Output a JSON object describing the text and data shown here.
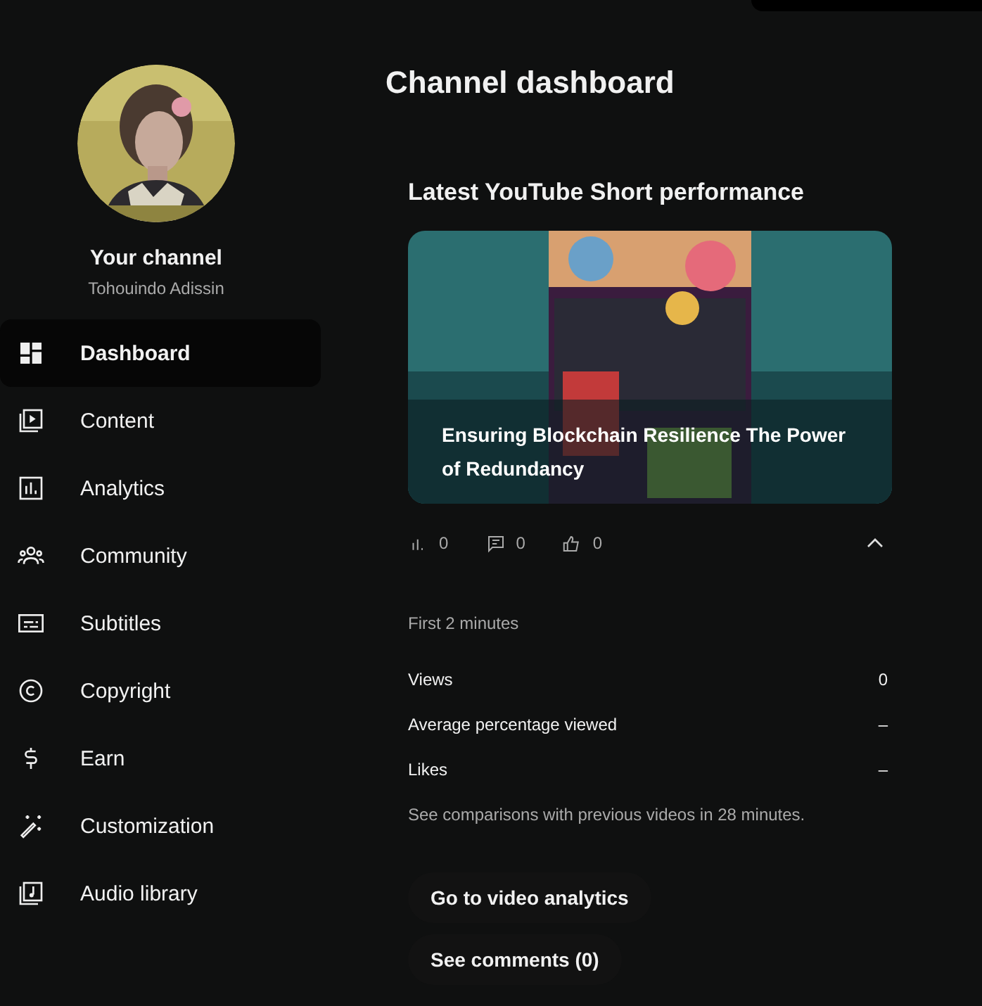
{
  "channel": {
    "title": "Your channel",
    "name": "Tohouindo Adissin"
  },
  "nav": [
    {
      "label": "Dashboard",
      "kind": "dashboard",
      "selected": true
    },
    {
      "label": "Content",
      "kind": "content",
      "selected": false
    },
    {
      "label": "Analytics",
      "kind": "analytics",
      "selected": false
    },
    {
      "label": "Community",
      "kind": "community",
      "selected": false
    },
    {
      "label": "Subtitles",
      "kind": "subtitles",
      "selected": false
    },
    {
      "label": "Copyright",
      "kind": "copyright",
      "selected": false
    },
    {
      "label": "Earn",
      "kind": "earn",
      "selected": false
    },
    {
      "label": "Customization",
      "kind": "customization",
      "selected": false
    },
    {
      "label": "Audio library",
      "kind": "audio",
      "selected": false
    }
  ],
  "page_title": "Channel dashboard",
  "short": {
    "heading": "Latest YouTube Short performance",
    "video_title": "Ensuring Blockchain Resilience The Power of Redundancy",
    "stats": [
      {
        "kind": "views",
        "value": "0"
      },
      {
        "kind": "comments",
        "value": "0"
      },
      {
        "kind": "likes",
        "value": "0"
      }
    ],
    "expanded": true,
    "period": "First 2 minutes",
    "metrics": [
      {
        "label": "Views",
        "value": "0"
      },
      {
        "label": "Average percentage viewed",
        "value": "–"
      },
      {
        "label": "Likes",
        "value": "–"
      }
    ],
    "note": "See comparisons with previous videos in 28 minutes.",
    "actions": [
      "Go to video analytics",
      "See comments (0)"
    ]
  }
}
